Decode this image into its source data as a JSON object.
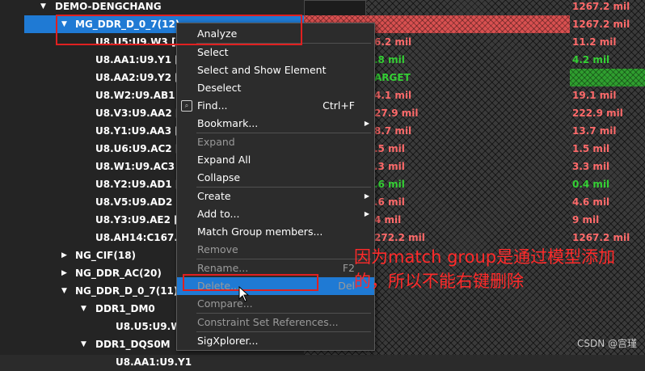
{
  "tree": {
    "rows": [
      {
        "indent": 0,
        "arrow": "▼",
        "name": "DEMO-DENGCHANG",
        "v1": "",
        "v2": "1267.2 mil",
        "v1c": "red",
        "v2c": "red"
      },
      {
        "indent": 1,
        "arrow": "▼",
        "name": "MG_DDR_D_0_7(12)",
        "v1": "",
        "v2": "1267.2 mil",
        "v1c": "red",
        "v2c": "red",
        "selected": true
      },
      {
        "indent": 2,
        "arrow": "",
        "name": "U8.U5:U9.W3 [D",
        "v1": "6.2 mil",
        "v2": "11.2 mil",
        "v1c": "red",
        "v2c": "red"
      },
      {
        "indent": 2,
        "arrow": "",
        "name": "U8.AA1:U9.Y1 [D",
        "v1": ".8 mil",
        "v2": "4.2 mil",
        "v1c": "green",
        "v2c": "green"
      },
      {
        "indent": 2,
        "arrow": "",
        "name": "U8.AA2:U9.Y2 [D",
        "v1": "ARGET",
        "v2": "",
        "v1c": "green",
        "v2c": "green"
      },
      {
        "indent": 2,
        "arrow": "",
        "name": "U8.W2:U9.AB1 [I",
        "v1": "4.1 mil",
        "v2": "19.1 mil",
        "v1c": "red",
        "v2c": "red"
      },
      {
        "indent": 2,
        "arrow": "",
        "name": "U8.V3:U9.AA2 [I",
        "v1": "27.9 mil",
        "v2": "222.9 mil",
        "v1c": "red",
        "v2c": "red"
      },
      {
        "indent": 2,
        "arrow": "",
        "name": "U8.Y1:U9.AA3 [D",
        "v1": "8.7 mil",
        "v2": "13.7 mil",
        "v1c": "red",
        "v2c": "red"
      },
      {
        "indent": 2,
        "arrow": "",
        "name": "U8.U6:U9.AC2 [D",
        "v1": ".5 mil",
        "v2": "1.5 mil",
        "v1c": "red",
        "v2c": "red"
      },
      {
        "indent": 2,
        "arrow": "",
        "name": "U8.W1:U9.AC3 [I",
        "v1": ".3 mil",
        "v2": "3.3 mil",
        "v1c": "red",
        "v2c": "red"
      },
      {
        "indent": 2,
        "arrow": "",
        "name": "U8.Y2:U9.AD1 [D",
        "v1": ".6 mil",
        "v2": "0.4 mil",
        "v1c": "green",
        "v2c": "green"
      },
      {
        "indent": 2,
        "arrow": "",
        "name": "U8.V5:U9.AD2 [D",
        "v1": ".6 mil",
        "v2": "4.6 mil",
        "v1c": "red",
        "v2c": "red"
      },
      {
        "indent": 2,
        "arrow": "",
        "name": "U8.Y3:U9.AE2 [D",
        "v1": "4 mil",
        "v2": "9 mil",
        "v1c": "red",
        "v2c": "red"
      },
      {
        "indent": 2,
        "arrow": "",
        "name": "U8.AH14:C167.1",
        "v1": "272.2 mil",
        "v2": "1267.2 mil",
        "v1c": "red",
        "v2c": "red"
      },
      {
        "indent": 1,
        "arrow": "▶",
        "name": "NG_CIF(18)",
        "v1": "",
        "v2": "",
        "v1c": "red",
        "v2c": "red"
      },
      {
        "indent": 1,
        "arrow": "▶",
        "name": "NG_DDR_AC(20)",
        "v1": "",
        "v2": "",
        "v1c": "red",
        "v2c": "red"
      },
      {
        "indent": 1,
        "arrow": "▼",
        "name": "NG_DDR_D_0_7(11)",
        "v1": "",
        "v2": "",
        "v1c": "red",
        "v2c": "red"
      },
      {
        "indent": 2,
        "arrow": "▼",
        "name": "DDR1_DM0",
        "v1": "",
        "v2": "",
        "v1c": "red",
        "v2c": "red"
      },
      {
        "indent": 3,
        "arrow": "",
        "name": "U8.U5:U9.W3",
        "v1": "",
        "v2": "",
        "v1c": "red",
        "v2c": "red"
      },
      {
        "indent": 2,
        "arrow": "▼",
        "name": "DDR1_DQS0M",
        "v1": "",
        "v2": "",
        "v1c": "red",
        "v2c": "red"
      },
      {
        "indent": 3,
        "arrow": "",
        "name": "U8.AA1:U9.Y1",
        "v1": "",
        "v2": "",
        "v1c": "red",
        "v2c": "red"
      }
    ]
  },
  "menu": {
    "items": [
      {
        "label": "Analyze",
        "shortcut": "",
        "submenu": false,
        "disabled": false
      },
      {
        "sep": true
      },
      {
        "label": "Select",
        "shortcut": "",
        "submenu": false,
        "disabled": false
      },
      {
        "label": "Select and Show Element",
        "shortcut": "",
        "submenu": false,
        "disabled": false
      },
      {
        "label": "Deselect",
        "shortcut": "",
        "submenu": false,
        "disabled": false
      },
      {
        "label": "Find...",
        "shortcut": "Ctrl+F",
        "submenu": false,
        "disabled": false,
        "icon": true
      },
      {
        "label": "Bookmark...",
        "shortcut": "",
        "submenu": true,
        "disabled": false
      },
      {
        "sep": true
      },
      {
        "label": "Expand",
        "shortcut": "",
        "submenu": false,
        "disabled": true
      },
      {
        "label": "Expand All",
        "shortcut": "",
        "submenu": false,
        "disabled": false
      },
      {
        "label": "Collapse",
        "shortcut": "",
        "submenu": false,
        "disabled": false
      },
      {
        "sep": true
      },
      {
        "label": "Create",
        "shortcut": "",
        "submenu": true,
        "disabled": false
      },
      {
        "label": "Add to...",
        "shortcut": "",
        "submenu": true,
        "disabled": false
      },
      {
        "label": "Match Group members...",
        "shortcut": "",
        "submenu": false,
        "disabled": false
      },
      {
        "label": "Remove",
        "shortcut": "",
        "submenu": false,
        "disabled": true
      },
      {
        "sep": true
      },
      {
        "label": "Rename...",
        "shortcut": "F2",
        "submenu": false,
        "disabled": true
      },
      {
        "label": "Delete...",
        "shortcut": "Del",
        "submenu": false,
        "disabled": true,
        "hover": true
      },
      {
        "label": "Compare...",
        "shortcut": "",
        "submenu": false,
        "disabled": true
      },
      {
        "sep": true
      },
      {
        "label": "Constraint Set References...",
        "shortcut": "",
        "submenu": false,
        "disabled": true
      },
      {
        "sep": true
      },
      {
        "label": "SigXplorer...",
        "shortcut": "",
        "submenu": false,
        "disabled": false
      }
    ]
  },
  "annotation": "因为match group是通过模型添加的，所以不能右键删除",
  "watermark": "CSDN @宫瑾",
  "colors": {
    "selection": "#1f7ad4",
    "red_value": "#ff6a6a",
    "green_value": "#34d034",
    "annotation": "#ff2a2a"
  }
}
